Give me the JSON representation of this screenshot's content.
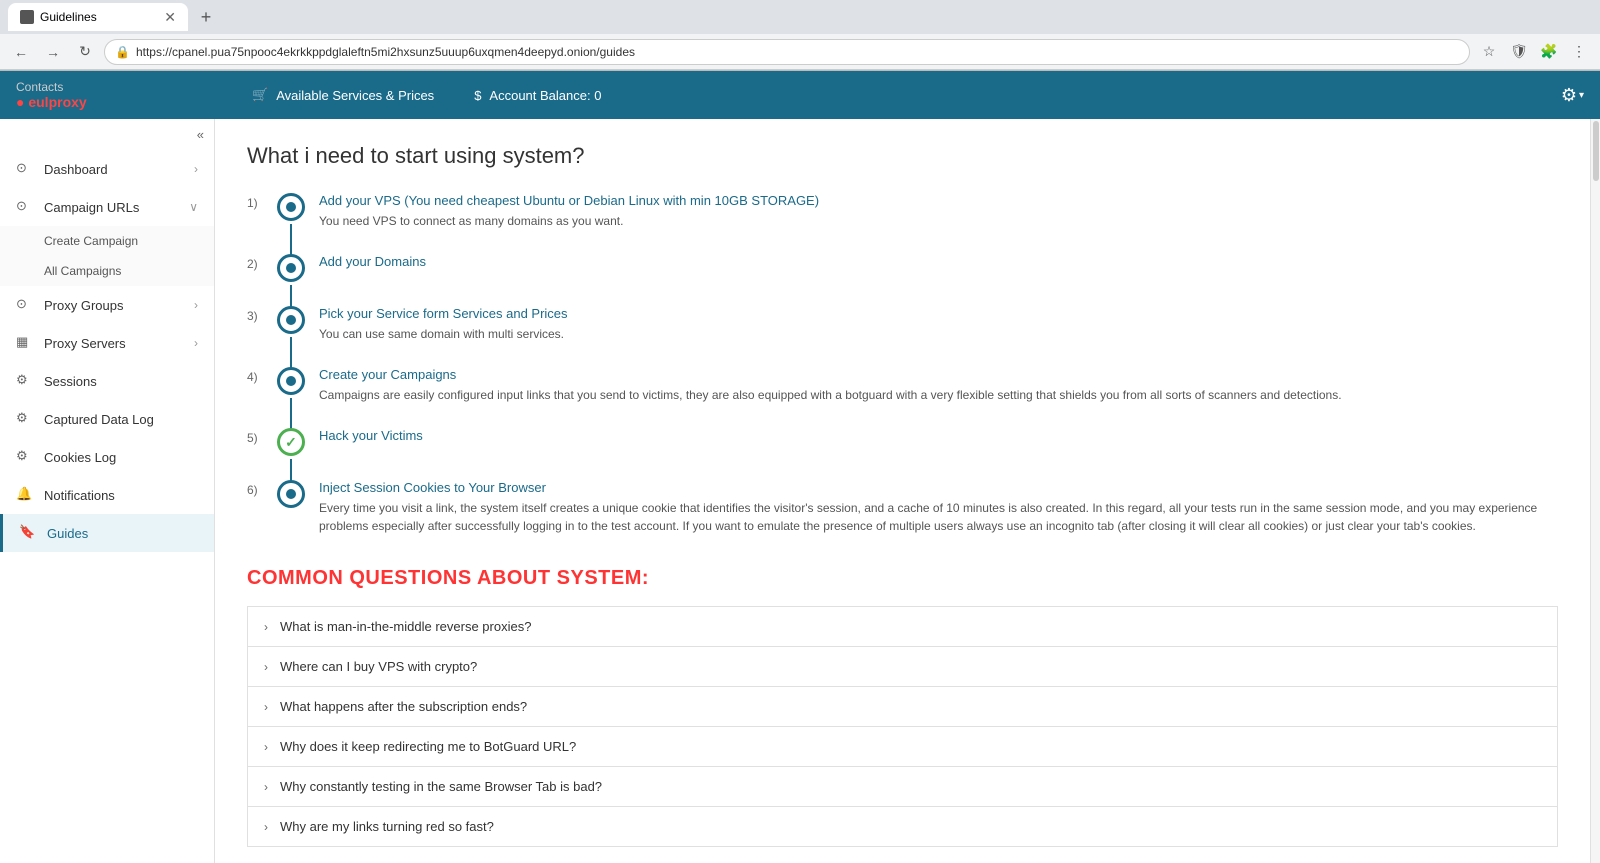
{
  "browser": {
    "tab_title": "Guidelines",
    "url": "https://cpanel.pua75npooc4ekrkkppdglaleftn5mi2hxsunz5uuup6uxqmen4deepyd.onion/guides",
    "new_tab_label": "+",
    "back_label": "←",
    "forward_label": "→",
    "refresh_label": "↻"
  },
  "header": {
    "brand_contacts": "Contacts",
    "brand_name": "● eulproxy",
    "nav_services": "🛒 Available Services & Prices",
    "nav_balance": "$ Account Balance: 0",
    "settings_label": "⚙"
  },
  "sidebar": {
    "collapse_icon": "«",
    "items": [
      {
        "id": "dashboard",
        "label": "Dashboard",
        "icon": "⊙",
        "hasChevron": true,
        "active": false
      },
      {
        "id": "campaign-urls",
        "label": "Campaign URLs",
        "icon": "⊙",
        "hasChevron": true,
        "active": false
      },
      {
        "id": "create-campaign",
        "label": "Create Campaign",
        "icon": "",
        "hasChevron": false,
        "isSub": true,
        "active": false
      },
      {
        "id": "all-campaigns",
        "label": "All Campaigns",
        "icon": "",
        "hasChevron": false,
        "isSub": true,
        "active": false
      },
      {
        "id": "proxy-groups",
        "label": "Proxy Groups",
        "icon": "⊙",
        "hasChevron": true,
        "active": false
      },
      {
        "id": "proxy-servers",
        "label": "Proxy Servers",
        "icon": "▦",
        "hasChevron": true,
        "active": false
      },
      {
        "id": "sessions",
        "label": "Sessions",
        "icon": "⚙",
        "hasChevron": false,
        "active": false
      },
      {
        "id": "captured-data",
        "label": "Captured Data Log",
        "icon": "⚙",
        "hasChevron": false,
        "active": false
      },
      {
        "id": "cookies-log",
        "label": "Cookies Log",
        "icon": "⚙",
        "hasChevron": false,
        "active": false
      },
      {
        "id": "notifications",
        "label": "Notifications",
        "icon": "🔔",
        "hasChevron": false,
        "active": false
      },
      {
        "id": "guides",
        "label": "Guides",
        "icon": "🔖",
        "hasChevron": false,
        "active": true
      }
    ]
  },
  "main": {
    "page_title": "What i need to start using system?",
    "steps": [
      {
        "num": "1)",
        "title": "Add your VPS (You need cheapest Ubuntu or Debian Linux with min 10GB STORAGE)",
        "desc": "You need VPS to connect as many domains as you want.",
        "type": "dot"
      },
      {
        "num": "2)",
        "title": "Add your Domains",
        "desc": "",
        "type": "dot"
      },
      {
        "num": "3)",
        "title": "Pick your Service form Services and Prices",
        "desc": "You can use same domain with multi services.",
        "type": "dot"
      },
      {
        "num": "4)",
        "title": "Create your Campaigns",
        "desc": "Campaigns are easily configured input links that you send to victims, they are also equipped with a botguard with a very flexible setting that shields you from all sorts of scanners and detections.",
        "type": "dot"
      },
      {
        "num": "5)",
        "title": "Hack your Victims",
        "desc": "",
        "type": "check"
      },
      {
        "num": "6)",
        "title": "Inject Session Cookies to Your Browser",
        "desc": "Every time you visit a link, the system itself creates a unique cookie that identifies the visitor's session, and a cache of 10 minutes is also created. In this regard, all your tests run in the same session mode, and you may experience problems especially after successfully logging in to the test account. If you want to emulate the presence of multiple users always use an incognito tab (after closing it will clear all cookies) or just clear your tab's cookies.",
        "type": "dot"
      }
    ],
    "faq_title": "COMMON QUESTIONS ABOUT SYSTEM:",
    "faq_items": [
      {
        "question": "What is man-in-the-middle reverse proxies?"
      },
      {
        "question": "Where can I buy VPS with crypto?"
      },
      {
        "question": "What happens after the subscription ends?"
      },
      {
        "question": "Why does it keep redirecting me to BotGuard URL?"
      },
      {
        "question": "Why constantly testing in the same Browser Tab is bad?"
      },
      {
        "question": "Why are my links turning red so fast?"
      }
    ]
  }
}
